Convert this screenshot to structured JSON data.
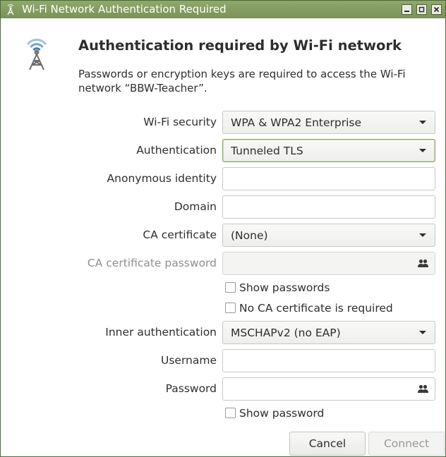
{
  "window": {
    "title": "Wi-Fi Network Authentication Required",
    "app_icon": "network-wireless-icon",
    "controls": [
      "minimize-icon",
      "maximize-icon",
      "close-icon"
    ]
  },
  "dialog": {
    "icon": "wireless-tower-icon",
    "heading": "Authentication required by Wi-Fi network",
    "description": "Passwords or encryption keys are required to access the Wi-Fi network “BBW-Teacher”."
  },
  "form": {
    "wifi_security": {
      "label": "Wi-Fi security",
      "value": "WPA & WPA2 Enterprise"
    },
    "authentication": {
      "label": "Authentication",
      "value": "Tunneled TLS"
    },
    "anonymous_identity": {
      "label": "Anonymous identity",
      "value": ""
    },
    "domain": {
      "label": "Domain",
      "value": ""
    },
    "ca_certificate": {
      "label": "CA certificate",
      "value": "(None)"
    },
    "ca_certificate_password": {
      "label": "CA certificate password",
      "value": "",
      "icon": "users-icon"
    },
    "show_passwords": {
      "label": "Show passwords",
      "checked": false
    },
    "no_ca_required": {
      "label": "No CA certificate is required",
      "checked": false
    },
    "inner_authentication": {
      "label": "Inner authentication",
      "value": "MSCHAPv2 (no EAP)"
    },
    "username": {
      "label": "Username",
      "value": ""
    },
    "password": {
      "label": "Password",
      "value": "",
      "icon": "users-icon"
    },
    "show_password": {
      "label": "Show password",
      "checked": false
    }
  },
  "buttons": {
    "cancel": "Cancel",
    "connect": "Connect"
  },
  "colors": {
    "titlebar": "#7f9a5d",
    "focus_border": "#8aa367",
    "disabled_text": "#8f8f8f"
  }
}
